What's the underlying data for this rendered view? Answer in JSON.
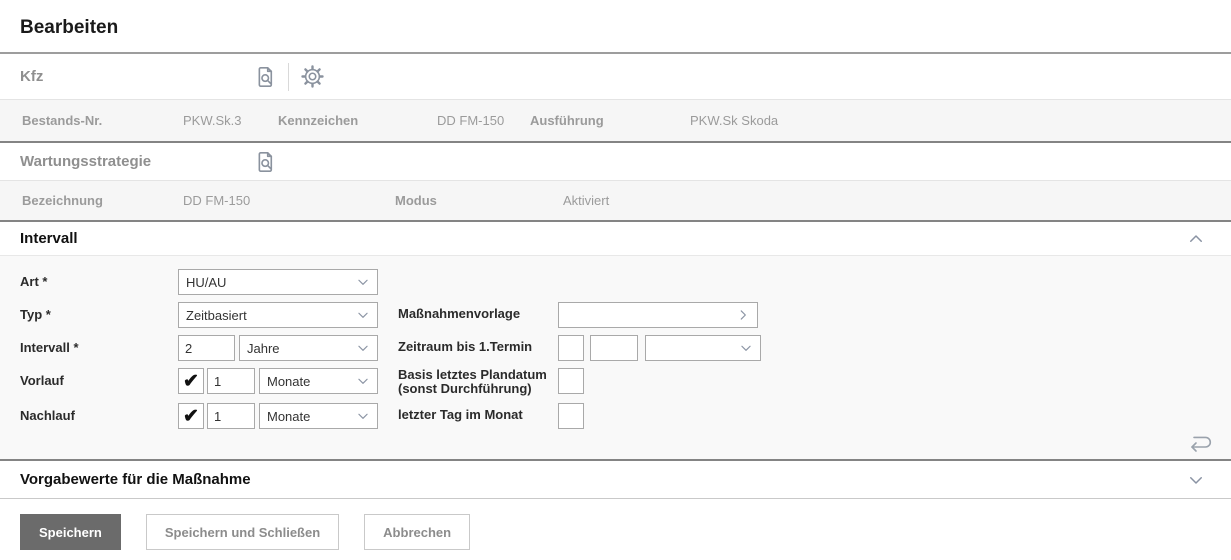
{
  "page": {
    "title": "Bearbeiten"
  },
  "kfz": {
    "title": "Kfz",
    "fields": [
      {
        "label": "Bestands-Nr.",
        "value": "PKW.Sk.3"
      },
      {
        "label": "Kennzeichen",
        "value": "DD FM-150"
      },
      {
        "label": "Ausführung",
        "value": "PKW.Sk Skoda"
      }
    ]
  },
  "wartungsstrategie": {
    "title": "Wartungsstrategie",
    "fields": [
      {
        "label": "Bezeichnung",
        "value": "DD FM-150"
      },
      {
        "label": "Modus",
        "value": "Aktiviert"
      }
    ]
  },
  "intervall": {
    "title": "Intervall",
    "art": {
      "label": "Art *",
      "value": "HU/AU"
    },
    "typ": {
      "label": "Typ *",
      "value": "Zeitbasiert"
    },
    "interval": {
      "label": "Intervall *",
      "value": "2",
      "unit": "Jahre"
    },
    "vorlauf": {
      "label": "Vorlauf",
      "checked": true,
      "value": "1",
      "unit": "Monate"
    },
    "nachlauf": {
      "label": "Nachlauf",
      "checked": true,
      "value": "1",
      "unit": "Monate"
    },
    "massnahmenvorlage": {
      "label": "Maßnahmenvorlage",
      "value": ""
    },
    "zeitraum": {
      "label": "Zeitraum bis 1.Termin",
      "value1": "",
      "value2": "",
      "unit": ""
    },
    "basis": {
      "label_line1": "Basis letztes Plandatum",
      "label_line2": "(sonst Durchführung)",
      "checked": false
    },
    "letzter_tag": {
      "label": "letzter Tag im Monat",
      "checked": false
    },
    "check_glyph": "✔"
  },
  "vorgabewerte": {
    "title": "Vorgabewerte für die Maßnahme"
  },
  "buttons": {
    "save": "Speichern",
    "save_close": "Speichern und Schließen",
    "cancel": "Abbrechen"
  },
  "colors": {
    "accent_dark_button": "#6b6b6b",
    "muted_text": "#9b9b9b",
    "icon_gray": "#8a929e",
    "section_divider": "#848484",
    "row_background": "#f6f6f6",
    "panel_background": "#f9f9f9"
  }
}
